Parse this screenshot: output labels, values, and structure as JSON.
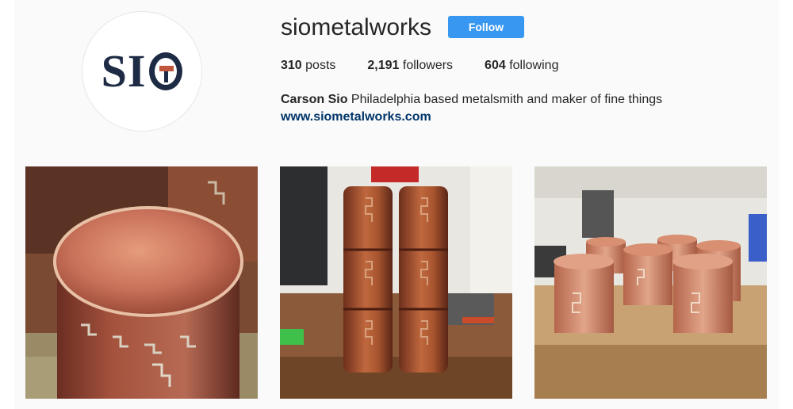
{
  "profile": {
    "username": "siometalworks",
    "follow_label": "Follow",
    "avatar_text": "SI",
    "stats": {
      "posts_count": "310",
      "posts_label": "posts",
      "followers_count": "2,191",
      "followers_label": "followers",
      "following_count": "604",
      "following_label": "following"
    },
    "full_name": "Carson Sio",
    "bio": "Philadelphia based metalsmith and maker of fine things",
    "website": "www.siometalworks.com"
  },
  "colors": {
    "follow_button": "#3897f0",
    "link": "#003569",
    "logo_navy": "#1e2b45",
    "copper": "#c0563c"
  },
  "posts": [
    {
      "subject": "copper canister with dovetail seams"
    },
    {
      "subject": "two stacked copper vessels"
    },
    {
      "subject": "copper cylinders on workbench"
    }
  ]
}
